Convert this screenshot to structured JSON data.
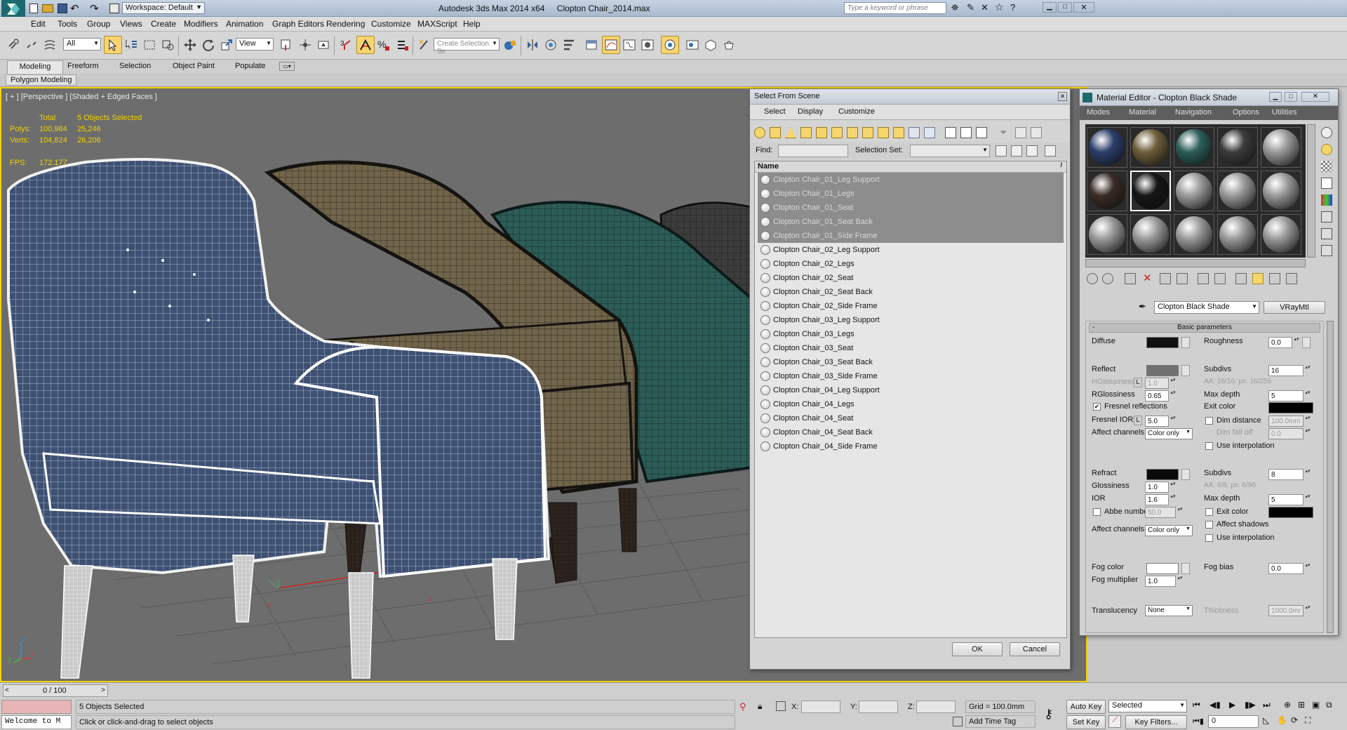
{
  "app": {
    "title": "Autodesk 3ds Max  2014 x64",
    "file": "Clopton Chair_2014.max",
    "workspace": "Workspace: Default",
    "search_placeholder": "Type a keyword or phrase"
  },
  "menu": [
    "Edit",
    "Tools",
    "Group",
    "Views",
    "Create",
    "Modifiers",
    "Animation",
    "Graph Editors",
    "Rendering",
    "Customize",
    "MAXScript",
    "Help"
  ],
  "toolbar": {
    "filter": "All",
    "ref_coord": "View",
    "snap_number": "3",
    "selection_set_placeholder": "Create Selection Se"
  },
  "ribbon": {
    "tabs": [
      "Modeling",
      "Freeform",
      "Selection",
      "Object Paint",
      "Populate"
    ],
    "sub": "Polygon Modeling"
  },
  "viewport": {
    "label": "[ + ] [Perspective ] [Shaded + Edged Faces ]",
    "stats": {
      "total_label": "Total",
      "selected_label": "5 Objects Selected",
      "polys_label": "Polys:",
      "polys_total": "100,984",
      "polys_sel": "25,246",
      "verts_label": "Verts:",
      "verts_total": "104,824",
      "verts_sel": "26,206",
      "fps_label": "FPS:",
      "fps": "172.177"
    },
    "axis": {
      "x": "x",
      "y": "y",
      "z": "z"
    },
    "gizmo": {
      "x": "x",
      "y": "y"
    }
  },
  "select_dialog": {
    "title": "Select From Scene",
    "tabs": [
      "Select",
      "Display",
      "Customize"
    ],
    "find_label": "Find:",
    "selection_set_label": "Selection Set:",
    "column_name": "Name",
    "items": [
      {
        "name": "Clopton Chair_01_Leg Support",
        "selected": true
      },
      {
        "name": "Clopton Chair_01_Legs",
        "selected": true
      },
      {
        "name": "Clopton Chair_01_Seat",
        "selected": true
      },
      {
        "name": "Clopton Chair_01_Seat Back",
        "selected": true
      },
      {
        "name": "Clopton Chair_01_Side Frame",
        "selected": true
      },
      {
        "name": "Clopton Chair_02_Leg Support",
        "selected": false
      },
      {
        "name": "Clopton Chair_02_Legs",
        "selected": false
      },
      {
        "name": "Clopton Chair_02_Seat",
        "selected": false
      },
      {
        "name": "Clopton Chair_02_Seat Back",
        "selected": false
      },
      {
        "name": "Clopton Chair_02_Side Frame",
        "selected": false
      },
      {
        "name": "Clopton Chair_03_Leg Support",
        "selected": false
      },
      {
        "name": "Clopton Chair_03_Legs",
        "selected": false
      },
      {
        "name": "Clopton Chair_03_Seat",
        "selected": false
      },
      {
        "name": "Clopton Chair_03_Seat Back",
        "selected": false
      },
      {
        "name": "Clopton Chair_03_Side Frame",
        "selected": false
      },
      {
        "name": "Clopton Chair_04_Leg Support",
        "selected": false
      },
      {
        "name": "Clopton Chair_04_Legs",
        "selected": false
      },
      {
        "name": "Clopton Chair_04_Seat",
        "selected": false
      },
      {
        "name": "Clopton Chair_04_Seat Back",
        "selected": false
      },
      {
        "name": "Clopton Chair_04_Side Frame",
        "selected": false
      }
    ],
    "ok": "OK",
    "cancel": "Cancel"
  },
  "material_editor": {
    "title": "Material Editor - Clopton Black Shade",
    "menu": [
      "Modes",
      "Material",
      "Navigation",
      "Options",
      "Utilities"
    ],
    "material_name": "Clopton Black Shade",
    "material_type": "VRayMtl",
    "rollout": "Basic parameters",
    "spheres": [
      "#2c3f6b",
      "#6e5e3a",
      "#2b5e58",
      "#3d3d3d",
      "#9a9a9a",
      "#3a2c26",
      "#151515",
      "#9a9a9a",
      "#9a9a9a",
      "#9a9a9a",
      "#9a9a9a",
      "#9a9a9a",
      "#9a9a9a",
      "#9a9a9a",
      "#9a9a9a"
    ],
    "diffuse": {
      "label": "Diffuse",
      "color": "#111111"
    },
    "roughness": {
      "label": "Roughness",
      "value": "0.0"
    },
    "reflect": {
      "label": "Reflect",
      "color": "#707070",
      "subdivs_label": "Subdivs",
      "subdivs": "16",
      "hgloss_label": "HGlossiness",
      "hgloss": "1.0",
      "hgloss_lock": "L",
      "aa_text": "AA: 16/16; px: 16/256",
      "rgloss_label": "RGlossiness",
      "rgloss": "0.65",
      "maxdepth_label": "Max depth",
      "maxdepth": "5",
      "fresnel_label": "Fresnel reflections",
      "fresnel_checked": "✔",
      "exit_color_label": "Exit color",
      "fresnel_ior_label": "Fresnel IOR",
      "fresnel_ior": "5.0",
      "fresnel_lock": "L",
      "dim_distance_label": "Dim distance",
      "dim_distance": "100.0mm",
      "dim_falloff_label": "Dim fall off",
      "dim_falloff": "0.0",
      "affect_label": "Affect channels",
      "affect": "Color only",
      "interp_label": "Use interpolation"
    },
    "refract": {
      "label": "Refract",
      "color": "#0a0a0a",
      "subdivs_label": "Subdivs",
      "subdivs": "8",
      "gloss_label": "Glossiness",
      "gloss": "1.0",
      "aa_text": "AA: 6/6; px: 6/96",
      "ior_label": "IOR",
      "ior": "1.6",
      "maxdepth_label": "Max depth",
      "maxdepth": "5",
      "abbe_label": "Abbe number",
      "abbe": "50.0",
      "exit_color_label": "Exit color",
      "shadows_label": "Affect shadows",
      "affect_label": "Affect channels",
      "affect": "Color only",
      "interp_label": "Use interpolation"
    },
    "fog": {
      "color_label": "Fog color",
      "color": "#ffffff",
      "bias_label": "Fog bias",
      "bias": "0.0",
      "mult_label": "Fog multiplier",
      "mult": "1.0"
    },
    "translucency": {
      "label": "Translucency",
      "value": "None",
      "thickness_label": "Thickness",
      "thickness": "1000.0mr"
    }
  },
  "timeline": {
    "frame": "0 / 100"
  },
  "status": {
    "welcome": "Welcome to M",
    "selected": "5 Objects Selected",
    "prompt": "Click or click-and-drag to select objects",
    "x_label": "X:",
    "y_label": "Y:",
    "z_label": "Z:",
    "grid": "Grid = 100.0mm",
    "add_time_tag": "Add Time Tag",
    "auto_key": "Auto Key",
    "set_key": "Set Key",
    "key_mode": "Selected",
    "key_filters": "Key Filters...",
    "frame": "0"
  }
}
